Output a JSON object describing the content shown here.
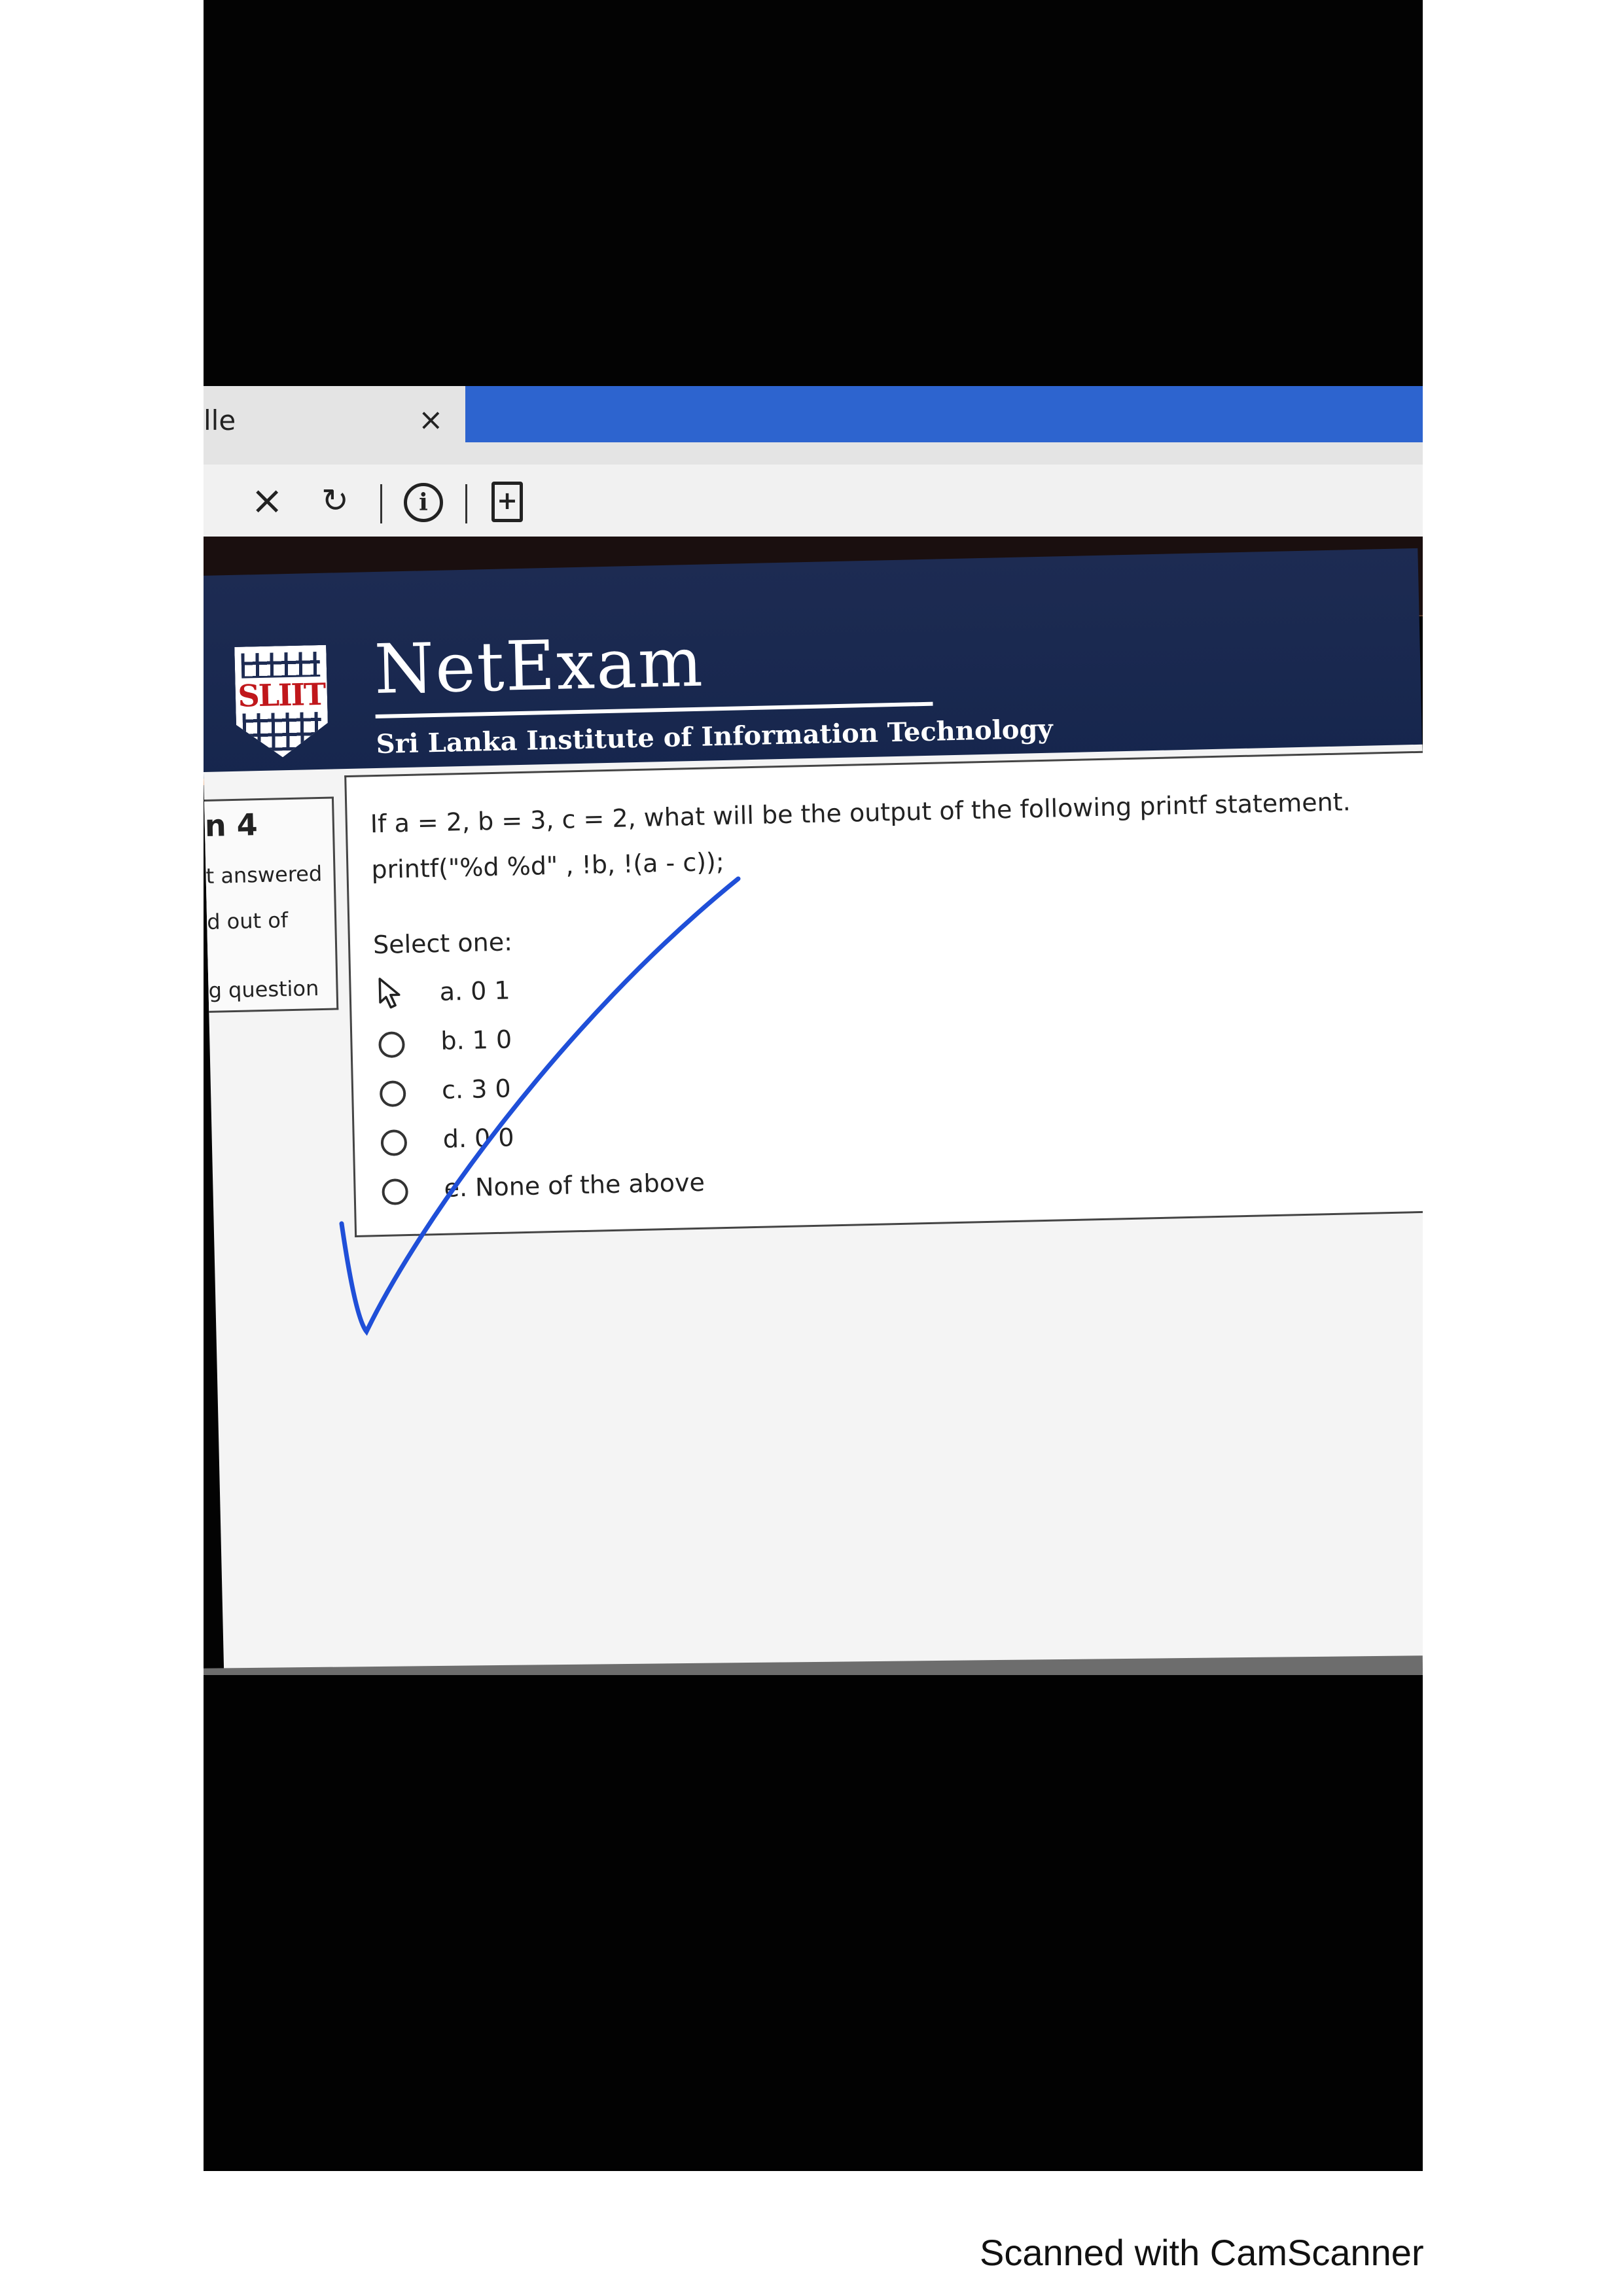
{
  "browser": {
    "tab_title": "lle",
    "tab_close": "×",
    "stop_glyph": "×",
    "reload_glyph": "↻",
    "info_glyph": "i",
    "page_glyph": "+"
  },
  "header": {
    "app_name": "NetExam",
    "logo_text": "SLIIT",
    "institution": "Sri Lanka Institute of Information Technology",
    "colors": {
      "banner": "#1d2b52",
      "accent": "#e2701f"
    }
  },
  "sidebar": {
    "question_number": "n 4",
    "status": "t answered",
    "marks": "d out of",
    "flag": "g question"
  },
  "question": {
    "text": "If a = 2, b = 3, c = 2, what will be the output of the following printf statement.",
    "code": "printf(\"%d %d\" , !b, !(a - c));",
    "prompt": "Select one:",
    "options": [
      {
        "label": "a. 0 1"
      },
      {
        "label": "b. 1 0"
      },
      {
        "label": "c. 3 0"
      },
      {
        "label": "d. 0 0"
      },
      {
        "label": "e. None of the above"
      }
    ]
  },
  "annotation": {
    "checkmark_color": "#1f4fd8"
  },
  "footer": {
    "scanner_text": "Scanned with CamScanner"
  }
}
